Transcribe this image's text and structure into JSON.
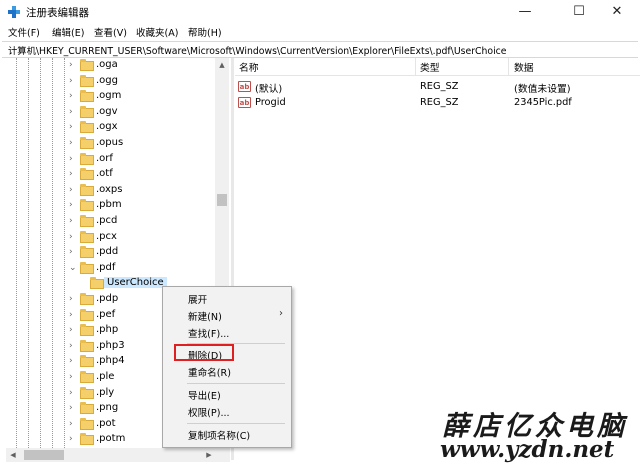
{
  "window": {
    "title": "注册表编辑器",
    "controls": {
      "minimize": "—",
      "maximize": "☐",
      "close": "✕"
    }
  },
  "menu": [
    "文件(F)",
    "编辑(E)",
    "查看(V)",
    "收藏夹(A)",
    "帮助(H)"
  ],
  "address": "计算机\\HKEY_CURRENT_USER\\Software\\Microsoft\\Windows\\CurrentVersion\\Explorer\\FileExts\\.pdf\\UserChoice",
  "tree": {
    "items": [
      {
        "label": ".oga",
        "expander": "›"
      },
      {
        "label": ".ogg",
        "expander": "›"
      },
      {
        "label": ".ogm",
        "expander": "›"
      },
      {
        "label": ".ogv",
        "expander": "›"
      },
      {
        "label": ".ogx",
        "expander": "›"
      },
      {
        "label": ".opus",
        "expander": "›"
      },
      {
        "label": ".orf",
        "expander": "›"
      },
      {
        "label": ".otf",
        "expander": "›"
      },
      {
        "label": ".oxps",
        "expander": "›"
      },
      {
        "label": ".pbm",
        "expander": "›"
      },
      {
        "label": ".pcd",
        "expander": "›"
      },
      {
        "label": ".pcx",
        "expander": "›"
      },
      {
        "label": ".pdd",
        "expander": "›"
      },
      {
        "label": ".pdf",
        "expander": "⌄"
      },
      {
        "label": "UserChoice",
        "expander": ""
      },
      {
        "label": ".pdp",
        "expander": "›"
      },
      {
        "label": ".pef",
        "expander": "›"
      },
      {
        "label": ".php",
        "expander": "›"
      },
      {
        "label": ".php3",
        "expander": "›"
      },
      {
        "label": ".php4",
        "expander": "›"
      },
      {
        "label": ".ple",
        "expander": "›"
      },
      {
        "label": ".ply",
        "expander": "›"
      },
      {
        "label": ".png",
        "expander": "›"
      },
      {
        "label": ".pot",
        "expander": "›"
      },
      {
        "label": ".potm",
        "expander": "›"
      }
    ]
  },
  "list": {
    "columns": [
      "名称",
      "类型",
      "数据"
    ],
    "rows": [
      {
        "icon": "ab",
        "name": "(默认)",
        "type": "REG_SZ",
        "data": "(数值未设置)"
      },
      {
        "icon": "ab",
        "name": "Progid",
        "type": "REG_SZ",
        "data": "2345Pic.pdf"
      }
    ]
  },
  "context_menu": {
    "items": [
      {
        "label": "展开",
        "submenu": ""
      },
      {
        "label": "新建(N)",
        "submenu": "›"
      },
      {
        "label": "查找(F)...",
        "submenu": ""
      },
      {
        "label": "删除(D)",
        "submenu": ""
      },
      {
        "label": "重命名(R)",
        "submenu": ""
      },
      {
        "label": "导出(E)",
        "submenu": ""
      },
      {
        "label": "权限(P)...",
        "submenu": ""
      },
      {
        "label": "复制项名称(C)",
        "submenu": ""
      }
    ]
  },
  "watermark": {
    "text": "薛店亿众电脑",
    "url": "www.yzdn.net"
  },
  "colors": {
    "highlight": "#e02020",
    "selected": "#cce8ff",
    "folder": "#f4cf6a"
  }
}
